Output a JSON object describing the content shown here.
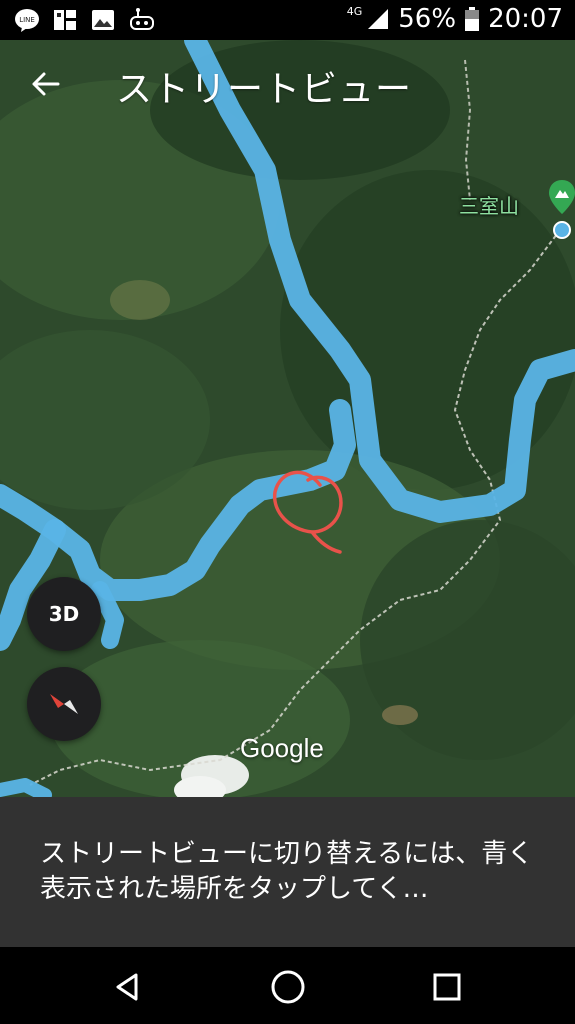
{
  "status_bar": {
    "network": "4G",
    "battery_percent": "56%",
    "time": "20:07",
    "left_icons": [
      "line-icon",
      "app-icon",
      "gallery-icon",
      "game-icon"
    ]
  },
  "app_bar": {
    "title": "ストリートビュー"
  },
  "map": {
    "mountain_label": "三室山",
    "google_logo": "Google",
    "controls": {
      "three_d_label": "3D"
    },
    "colors": {
      "streetview_line": "#5ab4e6",
      "annotation_circle": "#e8524a",
      "mountain_pin": "#34a853"
    }
  },
  "info_panel": {
    "message": "ストリートビューに切り替えるには、青く表示された場所をタップしてく…"
  },
  "nav_bar": {
    "buttons": [
      "back-triangle",
      "home-circle",
      "recents-square"
    ]
  }
}
